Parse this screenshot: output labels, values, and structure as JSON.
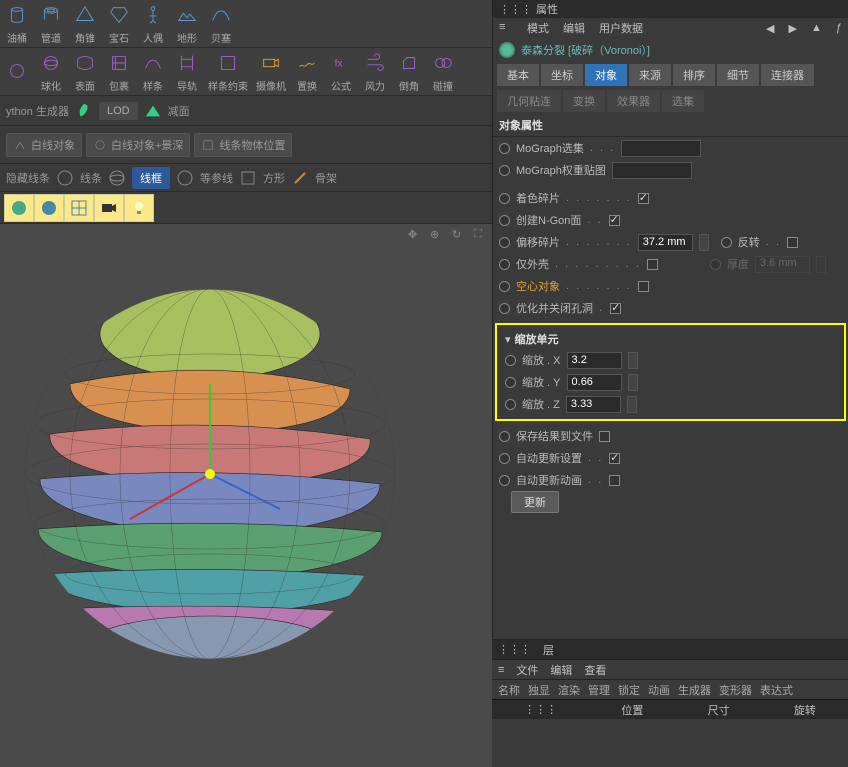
{
  "top_toolbar": [
    {
      "label": "油桶"
    },
    {
      "label": "管道"
    },
    {
      "label": "角锥"
    },
    {
      "label": "宝石"
    },
    {
      "label": "人偶"
    },
    {
      "label": "地形"
    },
    {
      "label": "贝塞"
    },
    {
      "label": ""
    }
  ],
  "second_toolbar": [
    {
      "label": ""
    },
    {
      "label": "球化"
    },
    {
      "label": "表面"
    },
    {
      "label": "包裹"
    },
    {
      "label": "样条"
    },
    {
      "label": "导轨"
    },
    {
      "label": "样条约束"
    },
    {
      "label": "摄像机"
    },
    {
      "label": "置换"
    },
    {
      "label": "公式"
    },
    {
      "label": "风力"
    },
    {
      "label": "倒角"
    },
    {
      "label": "碰撞"
    }
  ],
  "python_row": {
    "text": "ython 生成器",
    "lod": "LOD",
    "reduce": "减面"
  },
  "drag_row": [
    {
      "label": "白线对象"
    },
    {
      "label": "白线对象+景深"
    },
    {
      "label": "线条物体位置"
    }
  ],
  "view_tabs": {
    "hide": "隐藏线条",
    "line": "线条",
    "wireframe": "线框",
    "iso": "等参线",
    "square": "方形",
    "bone": "骨架"
  },
  "properties": {
    "header": "属性",
    "menu": [
      "模式",
      "编辑",
      "用户数据"
    ],
    "title": "泰森分裂 [破碎（Voronoi）]",
    "tabs_row1": [
      "基本",
      "坐标",
      "对象",
      "来源",
      "排序",
      "细节",
      "连接器"
    ],
    "tabs_row2": [
      "几何粘连",
      "变换",
      "效果器",
      "选集"
    ],
    "section": "对象属性",
    "mograph_sel": "MoGraph选集",
    "mograph_weight": "MoGraph权重贴图",
    "color_shards": "着色碎片",
    "create_ngon": "创建N-Gon面",
    "offset_shards": "偏移碎片",
    "offset_val": "37.2 mm",
    "reverse": "反转",
    "shell_only": "仅外壳",
    "thickness": "厚度",
    "thickness_val": "3.6 mm",
    "hollow": "空心对象",
    "optimize": "优化并关闭孔洞",
    "scale_unit": "缩放单元",
    "scale_x_label": "缩放 . X",
    "scale_x_val": "3.2",
    "scale_y_label": "缩放 . Y",
    "scale_y_val": "0.66",
    "scale_z_label": "缩放 . Z",
    "scale_z_val": "3.33",
    "save_result": "保存结果到文件",
    "auto_update_set": "自动更新设置",
    "auto_update_anim": "自动更新动画",
    "update_btn": "更新"
  },
  "bottom": {
    "layers": "层",
    "file_menu": [
      "文件",
      "编辑",
      "查看"
    ],
    "cols": [
      "名称",
      "独显",
      "渲染",
      "管理",
      "锁定",
      "动画",
      "生成器",
      "变形器",
      "表达式"
    ],
    "transform": [
      "位置",
      "尺寸",
      "旋转"
    ]
  }
}
